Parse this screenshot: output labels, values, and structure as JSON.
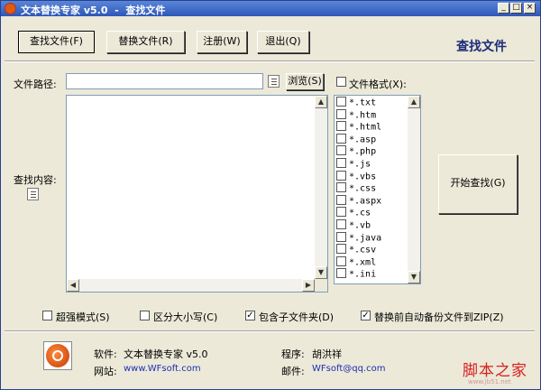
{
  "window": {
    "title": "文本替换专家 v5.0  -  查找文件",
    "minimize_glyph": "_",
    "maximize_glyph": "□",
    "close_glyph": "×"
  },
  "toolbar": {
    "find_label": "查找文件(F)",
    "replace_label": "替换文件(R)",
    "register_label": "注册(W)",
    "exit_label": "退出(Q)",
    "section_title": "查找文件"
  },
  "form": {
    "path_label": "文件路径:",
    "path_value": "",
    "browse_label": "浏览(S)",
    "file_format_label": "文件格式(X):",
    "content_label": "查找内容:",
    "content_value": "",
    "start_label": "开始查找(G)"
  },
  "file_types": [
    "*.txt",
    "*.htm",
    "*.html",
    "*.asp",
    "*.php",
    "*.js",
    "*.vbs",
    "*.css",
    "*.aspx",
    "*.cs",
    "*.vb",
    "*.java",
    "*.csv",
    "*.xml",
    "*.ini"
  ],
  "options": {
    "super_mode": "超强模式(S)",
    "case_sensitive": "区分大小写(C)",
    "include_subfolders": "包含子文件夹(D)",
    "backup_zip": "替换前自动备份文件到ZIP(Z)",
    "check_mark": "✓"
  },
  "footer": {
    "software_label": "软件:",
    "software_value": "文本替换专家 v5.0",
    "website_label": "网站:",
    "website_value": "www.WFsoft.com",
    "author_label": "程序:",
    "author_value": "胡洪祥",
    "email_label": "邮件:",
    "email_value": "WFsoft@qq.com",
    "watermark": "脚本之家",
    "watermark_sub": "www.jb51.net"
  }
}
